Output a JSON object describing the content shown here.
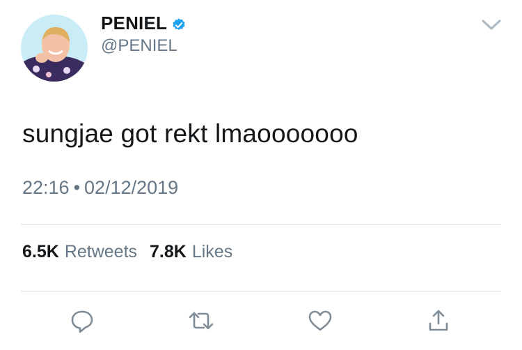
{
  "user": {
    "display_name": "PENIEL",
    "handle": "@PENIEL",
    "verified": true
  },
  "tweet": {
    "text": "sungjae got rekt lmaooooooo",
    "time": "22:16",
    "separator": "•",
    "date": "02/12/2019"
  },
  "stats": {
    "retweets_count": "6.5K",
    "retweets_label": "Retweets",
    "likes_count": "7.8K",
    "likes_label": "Likes"
  },
  "actions": [
    "reply-icon",
    "retweet-icon",
    "like-icon",
    "share-icon"
  ],
  "colors": {
    "text": "#14171a",
    "secondary": "#657786",
    "verified": "#1da1f2",
    "divider": "#d6dde2"
  }
}
